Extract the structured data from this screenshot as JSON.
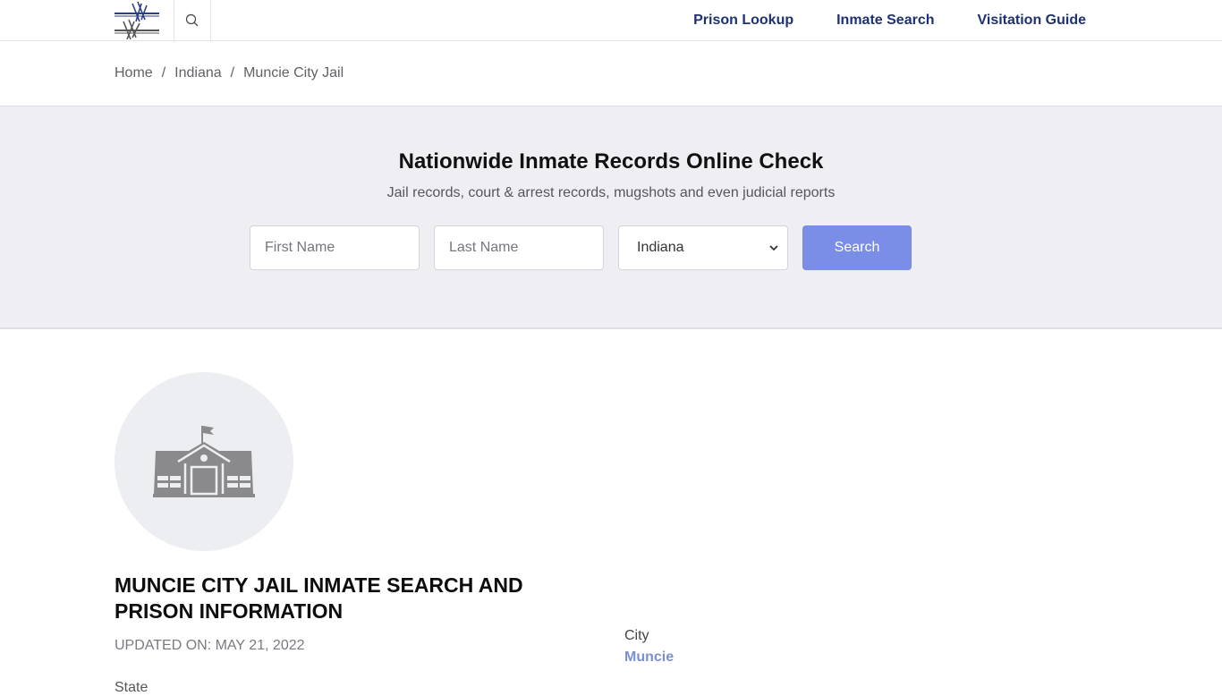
{
  "header": {
    "logo": "barbed-wire-logo",
    "search_icon": "search-icon",
    "nav": [
      {
        "label": "Prison Lookup"
      },
      {
        "label": "Inmate Search"
      },
      {
        "label": "Visitation Guide"
      }
    ]
  },
  "breadcrumb": {
    "items": [
      "Home",
      "Indiana",
      "Muncie City Jail"
    ],
    "separator": "/"
  },
  "hero": {
    "title": "Nationwide Inmate Records Online Check",
    "subtitle": "Jail records, court & arrest records, mugshots and even judicial reports",
    "first_name_placeholder": "First Name",
    "last_name_placeholder": "Last Name",
    "state_selected": "Indiana",
    "search_label": "Search"
  },
  "facility": {
    "icon": "building-icon",
    "title": "MUNCIE CITY JAIL INMATE SEARCH AND PRISON INFORMATION",
    "updated": "UPDATED ON: MAY 21, 2022",
    "state_label": "State",
    "city_label": "City",
    "city_value": "Muncie"
  },
  "colors": {
    "nav_text": "#1f3170",
    "button": "#7a8ee8",
    "hero_bg": "#efeff3",
    "link": "#7d8fcf"
  }
}
